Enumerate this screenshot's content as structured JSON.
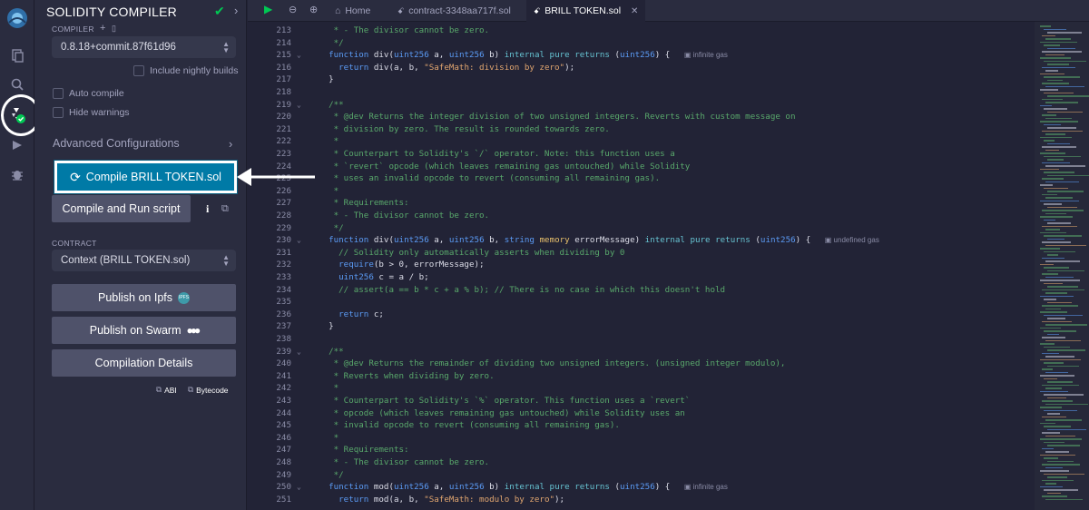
{
  "iconbar": {
    "items": [
      "remix-logo",
      "file-explorer-icon",
      "search-icon",
      "solidity-compiler-icon",
      "deploy-run-icon",
      "debugger-icon"
    ]
  },
  "panel": {
    "title": "SOLIDITY COMPILER",
    "compiler_label": "COMPILER",
    "compiler_version": "0.8.18+commit.87f61d96",
    "include_nightly": "Include nightly builds",
    "auto_compile": "Auto compile",
    "hide_warnings": "Hide warnings",
    "advanced": "Advanced Configurations",
    "compile_button": "Compile BRILL TOKEN.sol",
    "compile_run_button": "Compile and Run script",
    "contract_label": "CONTRACT",
    "contract_value": "Context (BRILL TOKEN.sol)",
    "publish_ipfs": "Publish on Ipfs",
    "ipfs_badge": "IPFS",
    "publish_swarm": "Publish on Swarm",
    "compilation_details": "Compilation Details",
    "abi": "ABI",
    "bytecode": "Bytecode"
  },
  "tabs": {
    "home": "Home",
    "file1": "contract-3348aa717f.sol",
    "file2": "BRILL TOKEN.sol"
  },
  "editor": {
    "lines": [
      {
        "n": "213",
        "fold": "",
        "parts": [
          [
            "c-com",
            "   * - The divisor cannot be zero."
          ]
        ]
      },
      {
        "n": "214",
        "fold": "",
        "parts": [
          [
            "c-com",
            "   */"
          ]
        ]
      },
      {
        "n": "215",
        "fold": "v",
        "parts": [
          [
            "c-kw",
            "  function "
          ],
          [
            "c-id",
            "div("
          ],
          [
            "c-kw",
            "uint256"
          ],
          [
            "c-id",
            " a, "
          ],
          [
            "c-kw",
            "uint256"
          ],
          [
            "c-id",
            " b) "
          ],
          [
            "c-kw2",
            "internal pure returns"
          ],
          [
            "c-id",
            " ("
          ],
          [
            "c-kw",
            "uint256"
          ],
          [
            "c-id",
            ") {  "
          ]
        ],
        "gas": "infinite gas"
      },
      {
        "n": "216",
        "fold": "",
        "parts": [
          [
            "c-kw",
            "    return "
          ],
          [
            "c-id",
            "div(a, b, "
          ],
          [
            "c-str",
            "\"SafeMath: division by zero\""
          ],
          [
            "c-id",
            ");"
          ]
        ]
      },
      {
        "n": "217",
        "fold": "",
        "parts": [
          [
            "c-id",
            "  }"
          ]
        ]
      },
      {
        "n": "218",
        "fold": "",
        "parts": [
          [
            "c-id",
            ""
          ]
        ]
      },
      {
        "n": "219",
        "fold": "v",
        "parts": [
          [
            "c-com",
            "  /**"
          ]
        ]
      },
      {
        "n": "220",
        "fold": "",
        "parts": [
          [
            "c-com",
            "   * @dev Returns the integer division of two unsigned integers. Reverts with custom message on"
          ]
        ]
      },
      {
        "n": "221",
        "fold": "",
        "parts": [
          [
            "c-com",
            "   * division by zero. The result is rounded towards zero."
          ]
        ]
      },
      {
        "n": "222",
        "fold": "",
        "parts": [
          [
            "c-com",
            "   *"
          ]
        ]
      },
      {
        "n": "223",
        "fold": "",
        "parts": [
          [
            "c-com",
            "   * Counterpart to Solidity's `/` operator. Note: this function uses a"
          ]
        ]
      },
      {
        "n": "224",
        "fold": "",
        "parts": [
          [
            "c-com",
            "   * `revert` opcode (which leaves remaining gas untouched) while Solidity"
          ]
        ]
      },
      {
        "n": "225",
        "fold": "",
        "parts": [
          [
            "c-com",
            "   * uses an invalid opcode to revert (consuming all remaining gas)."
          ]
        ]
      },
      {
        "n": "226",
        "fold": "",
        "parts": [
          [
            "c-com",
            "   *"
          ]
        ]
      },
      {
        "n": "227",
        "fold": "",
        "parts": [
          [
            "c-com",
            "   * Requirements:"
          ]
        ]
      },
      {
        "n": "228",
        "fold": "",
        "parts": [
          [
            "c-com",
            "   * - The divisor cannot be zero."
          ]
        ]
      },
      {
        "n": "229",
        "fold": "",
        "parts": [
          [
            "c-com",
            "   */"
          ]
        ]
      },
      {
        "n": "230",
        "fold": "v",
        "parts": [
          [
            "c-kw",
            "  function "
          ],
          [
            "c-id",
            "div("
          ],
          [
            "c-kw",
            "uint256"
          ],
          [
            "c-id",
            " a, "
          ],
          [
            "c-kw",
            "uint256"
          ],
          [
            "c-id",
            " b, "
          ],
          [
            "c-kw",
            "string"
          ],
          [
            "c-mem",
            " memory"
          ],
          [
            "c-id",
            " errorMessage) "
          ],
          [
            "c-kw2",
            "internal pure returns"
          ],
          [
            "c-id",
            " ("
          ],
          [
            "c-kw",
            "uint256"
          ],
          [
            "c-id",
            ") {  "
          ]
        ],
        "gas": "undefined gas"
      },
      {
        "n": "231",
        "fold": "",
        "parts": [
          [
            "c-com",
            "    // Solidity only automatically asserts when dividing by 0"
          ]
        ]
      },
      {
        "n": "232",
        "fold": "",
        "parts": [
          [
            "c-kw",
            "    require"
          ],
          [
            "c-id",
            "(b > 0, errorMessage);"
          ]
        ]
      },
      {
        "n": "233",
        "fold": "",
        "parts": [
          [
            "c-kw",
            "    uint256"
          ],
          [
            "c-id",
            " c = a / b;"
          ]
        ]
      },
      {
        "n": "234",
        "fold": "",
        "parts": [
          [
            "c-com",
            "    // assert(a == b * c + a % b); // There is no case in which this doesn't hold"
          ]
        ]
      },
      {
        "n": "235",
        "fold": "",
        "parts": [
          [
            "c-id",
            ""
          ]
        ]
      },
      {
        "n": "236",
        "fold": "",
        "parts": [
          [
            "c-kw",
            "    return "
          ],
          [
            "c-id",
            "c;"
          ]
        ]
      },
      {
        "n": "237",
        "fold": "",
        "parts": [
          [
            "c-id",
            "  }"
          ]
        ]
      },
      {
        "n": "238",
        "fold": "",
        "parts": [
          [
            "c-id",
            ""
          ]
        ]
      },
      {
        "n": "239",
        "fold": "v",
        "parts": [
          [
            "c-com",
            "  /**"
          ]
        ]
      },
      {
        "n": "240",
        "fold": "",
        "parts": [
          [
            "c-com",
            "   * @dev Returns the remainder of dividing two unsigned integers. (unsigned integer modulo),"
          ]
        ]
      },
      {
        "n": "241",
        "fold": "",
        "parts": [
          [
            "c-com",
            "   * Reverts when dividing by zero."
          ]
        ]
      },
      {
        "n": "242",
        "fold": "",
        "parts": [
          [
            "c-com",
            "   *"
          ]
        ]
      },
      {
        "n": "243",
        "fold": "",
        "parts": [
          [
            "c-com",
            "   * Counterpart to Solidity's `%` operator. This function uses a `revert`"
          ]
        ]
      },
      {
        "n": "244",
        "fold": "",
        "parts": [
          [
            "c-com",
            "   * opcode (which leaves remaining gas untouched) while Solidity uses an"
          ]
        ]
      },
      {
        "n": "245",
        "fold": "",
        "parts": [
          [
            "c-com",
            "   * invalid opcode to revert (consuming all remaining gas)."
          ]
        ]
      },
      {
        "n": "246",
        "fold": "",
        "parts": [
          [
            "c-com",
            "   *"
          ]
        ]
      },
      {
        "n": "247",
        "fold": "",
        "parts": [
          [
            "c-com",
            "   * Requirements:"
          ]
        ]
      },
      {
        "n": "248",
        "fold": "",
        "parts": [
          [
            "c-com",
            "   * - The divisor cannot be zero."
          ]
        ]
      },
      {
        "n": "249",
        "fold": "",
        "parts": [
          [
            "c-com",
            "   */"
          ]
        ]
      },
      {
        "n": "250",
        "fold": "v",
        "parts": [
          [
            "c-kw",
            "  function "
          ],
          [
            "c-id",
            "mod("
          ],
          [
            "c-kw",
            "uint256"
          ],
          [
            "c-id",
            " a, "
          ],
          [
            "c-kw",
            "uint256"
          ],
          [
            "c-id",
            " b) "
          ],
          [
            "c-kw2",
            "internal pure returns"
          ],
          [
            "c-id",
            " ("
          ],
          [
            "c-kw",
            "uint256"
          ],
          [
            "c-id",
            ") {  "
          ]
        ],
        "gas": "infinite gas"
      },
      {
        "n": "251",
        "fold": "",
        "parts": [
          [
            "c-kw",
            "    return "
          ],
          [
            "c-id",
            "mod(a, b, "
          ],
          [
            "c-str",
            "\"SafeMath: modulo by zero\""
          ],
          [
            "c-id",
            ");"
          ]
        ]
      }
    ]
  },
  "colors": {
    "accent": "#007aa6",
    "background": "#222336",
    "panel": "#2a2c3f",
    "success": "#00c853"
  }
}
